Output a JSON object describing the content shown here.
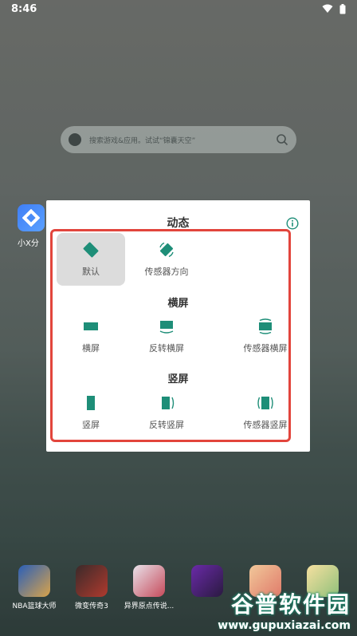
{
  "status_bar": {
    "time": "8:46"
  },
  "search": {
    "placeholder": "搜索游戏&应用。试试“锦囊天空”"
  },
  "home": {
    "app_label": "小X分"
  },
  "dock": [
    {
      "label": "NBA篮球大师"
    },
    {
      "label": "微变传奇3"
    },
    {
      "label": "异界原点传说..."
    },
    {
      "label": ""
    },
    {
      "label": ""
    },
    {
      "label": ""
    }
  ],
  "watermark": {
    "title": "谷普软件园",
    "url": "www.gupuxiazai.com"
  },
  "dialog": {
    "title": "动态",
    "sections": {
      "landscape_title": "横屏",
      "portrait_title": "竖屏"
    },
    "options": {
      "default": "默认",
      "sensor_direction": "传感器方向",
      "landscape": "横屏",
      "reverse_landscape": "反转横屏",
      "sensor_landscape": "传感器横屏",
      "portrait": "竖屏",
      "reverse_portrait": "反转竖屏",
      "sensor_portrait": "传感器竖屏"
    },
    "selected": "default"
  },
  "colors": {
    "accent": "#1e8e78",
    "highlight_frame": "#e2453c"
  }
}
